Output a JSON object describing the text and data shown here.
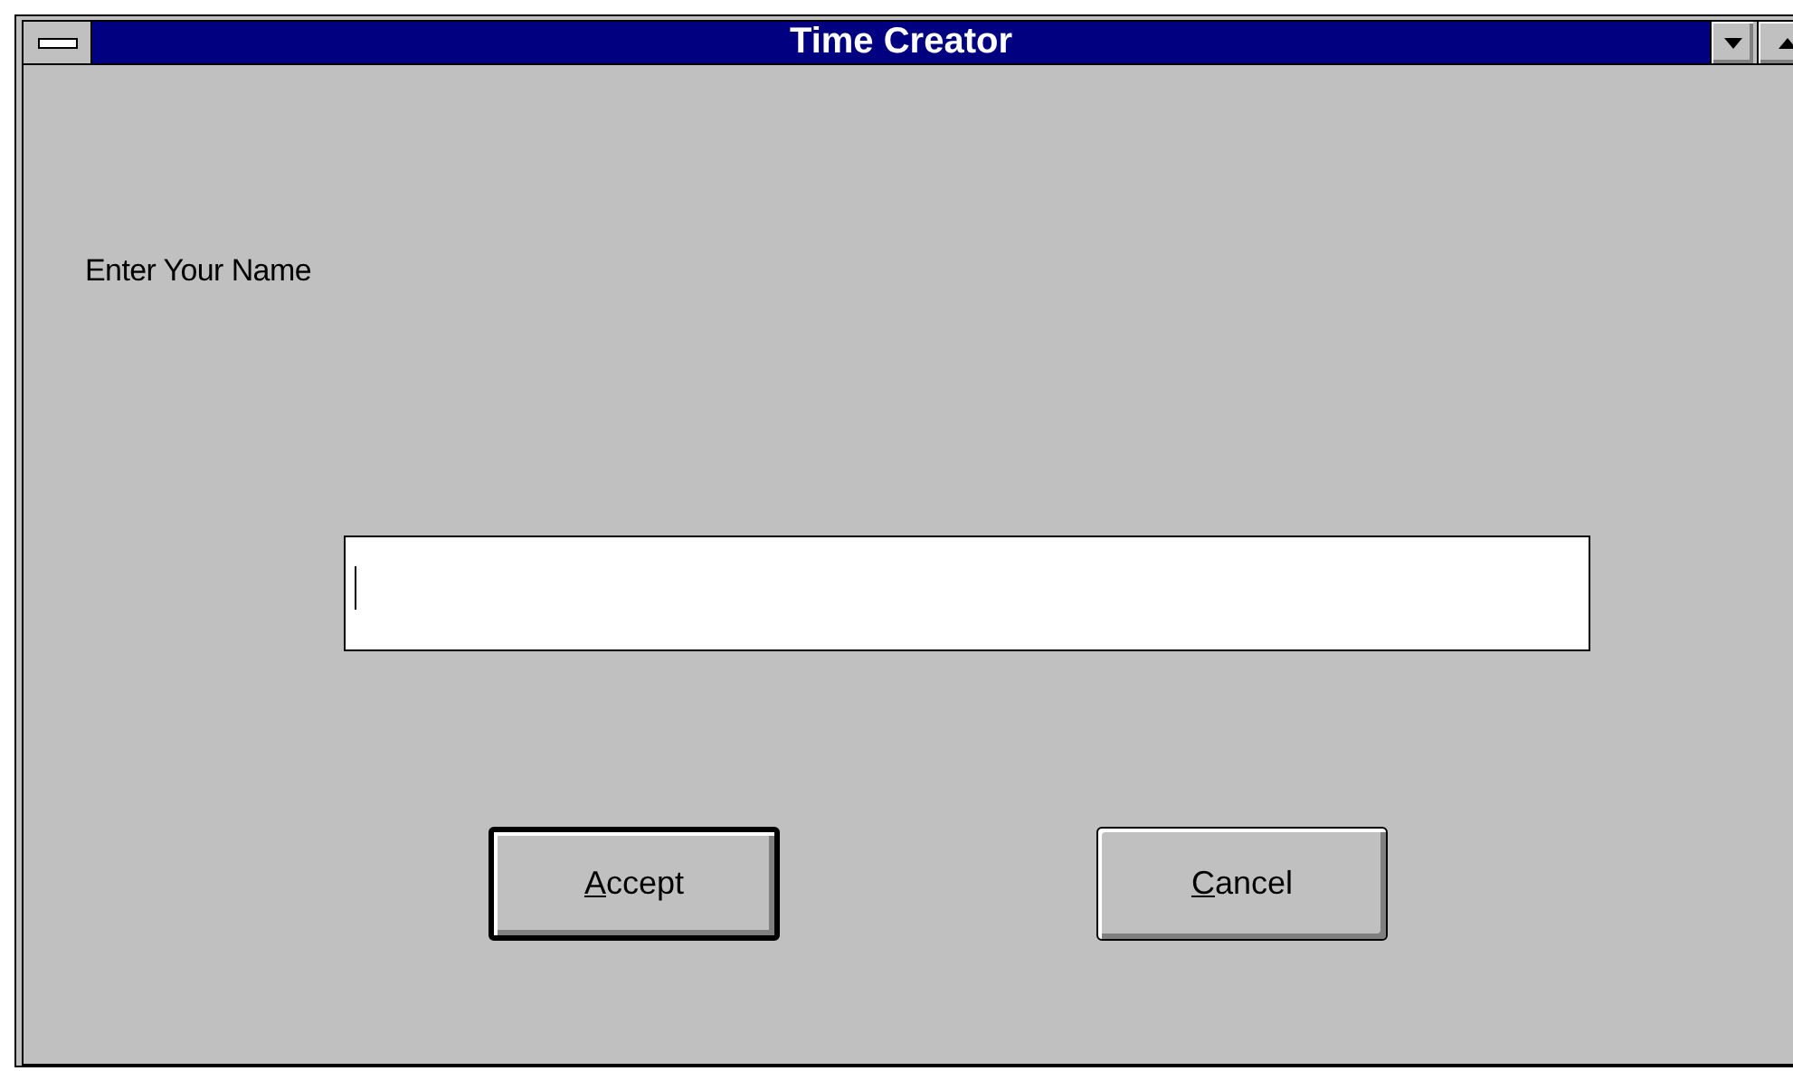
{
  "window": {
    "title": "Time Creator"
  },
  "prompt": "Enter Your Name",
  "name_field": {
    "focused": true
  },
  "buttons": [
    {
      "label": "Accept",
      "default": true
    },
    {
      "label": "Cancel",
      "default": false
    }
  ]
}
